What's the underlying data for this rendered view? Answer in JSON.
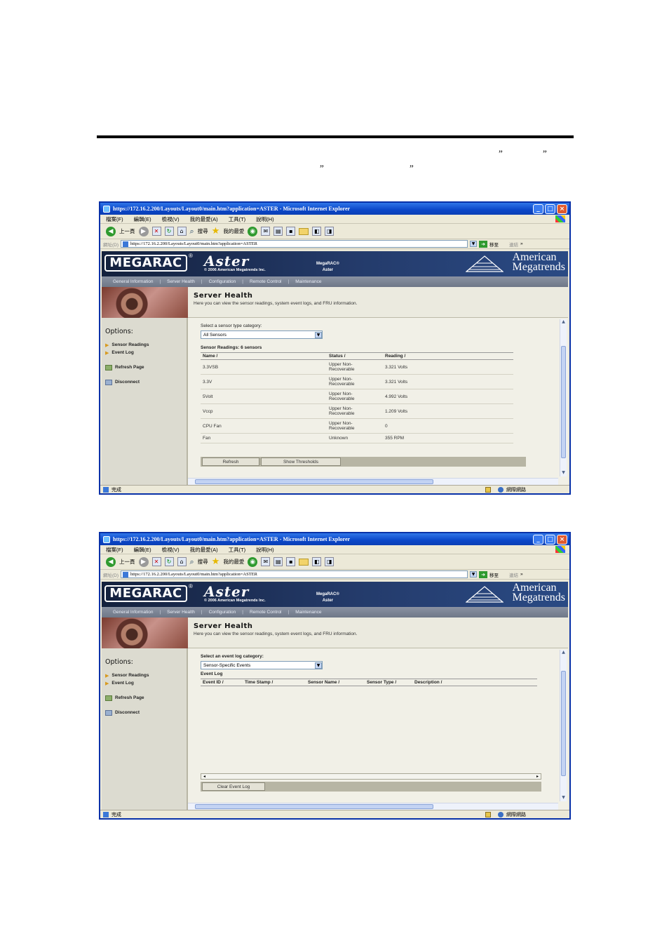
{
  "doc": {
    "quotes_line1": [
      "”",
      "”"
    ],
    "quotes_line2": [
      "”",
      "”"
    ]
  },
  "browser": {
    "title": "https://172.16.2.200/Layouts/Layout0/main.htm?application=ASTER - Microsoft Internet Explorer",
    "menu": [
      "檔案(F)",
      "編輯(E)",
      "檢視(V)",
      "我的最愛(A)",
      "工具(T)",
      "說明(H)"
    ],
    "toolbar": {
      "back": "上一頁",
      "search": "搜尋",
      "favorites": "我的最愛"
    },
    "address_label": "網址(D)",
    "address": "https://172.16.2.200/Layouts/Layout0/main.htm?application=ASTER",
    "go": "移至",
    "links": "連結",
    "chevron": "»",
    "status_done": "完成",
    "status_zone": "網際網路"
  },
  "app": {
    "logo": "MEGARAC",
    "reg": "®",
    "product": "Aster",
    "copyright": "© 2006 American Megatrends Inc.",
    "megarac_center": [
      "MegaRAC®",
      "Aster"
    ],
    "company": [
      "American",
      "Megatrends"
    ],
    "nav": [
      "General Information",
      "Server Health",
      "Configuration",
      "Remote Control",
      "Maintenance"
    ],
    "page_title": "Server Health",
    "page_desc": "Here you can view the sensor readings, system event logs, and FRU information.",
    "options_title": "Options:",
    "options": {
      "sensor_readings": "Sensor Readings",
      "event_log": "Event Log",
      "refresh_page": "Refresh Page",
      "disconnect": "Disconnect"
    }
  },
  "sensors_view": {
    "select_label": "Select a sensor type category:",
    "select_value": "All Sensors",
    "readings_title": "Sensor Readings: 6 sensors",
    "columns": [
      "Name",
      "Status",
      "Reading"
    ],
    "sort_mark": "/",
    "rows": [
      {
        "name": "3.3VSB",
        "status": [
          "Upper Non-",
          "Recoverable"
        ],
        "reading": "3.321 Volts"
      },
      {
        "name": "3.3V",
        "status": [
          "Upper Non-",
          "Recoverable"
        ],
        "reading": "3.321 Volts"
      },
      {
        "name": "5Volt",
        "status": [
          "Upper Non-",
          "Recoverable"
        ],
        "reading": "4.992 Volts"
      },
      {
        "name": "Vccp",
        "status": [
          "Upper Non-",
          "Recoverable"
        ],
        "reading": "1.209 Volts"
      },
      {
        "name": "CPU Fan",
        "status": [
          "Upper Non-",
          "Recoverable"
        ],
        "reading": "0"
      },
      {
        "name": "Fan",
        "status": [
          "Unknown",
          ""
        ],
        "reading": "355 RPM"
      }
    ],
    "buttons": {
      "refresh": "Refresh",
      "thresholds": "Show Thresholds"
    }
  },
  "eventlog_view": {
    "select_label": "Select an event log category:",
    "select_value": "Sensor-Specific Events",
    "log_title": "Event Log",
    "columns": [
      "Event ID",
      "Time Stamp",
      "Sensor Name",
      "Sensor Type",
      "Description"
    ],
    "button_clear": "Clear Event Log"
  }
}
